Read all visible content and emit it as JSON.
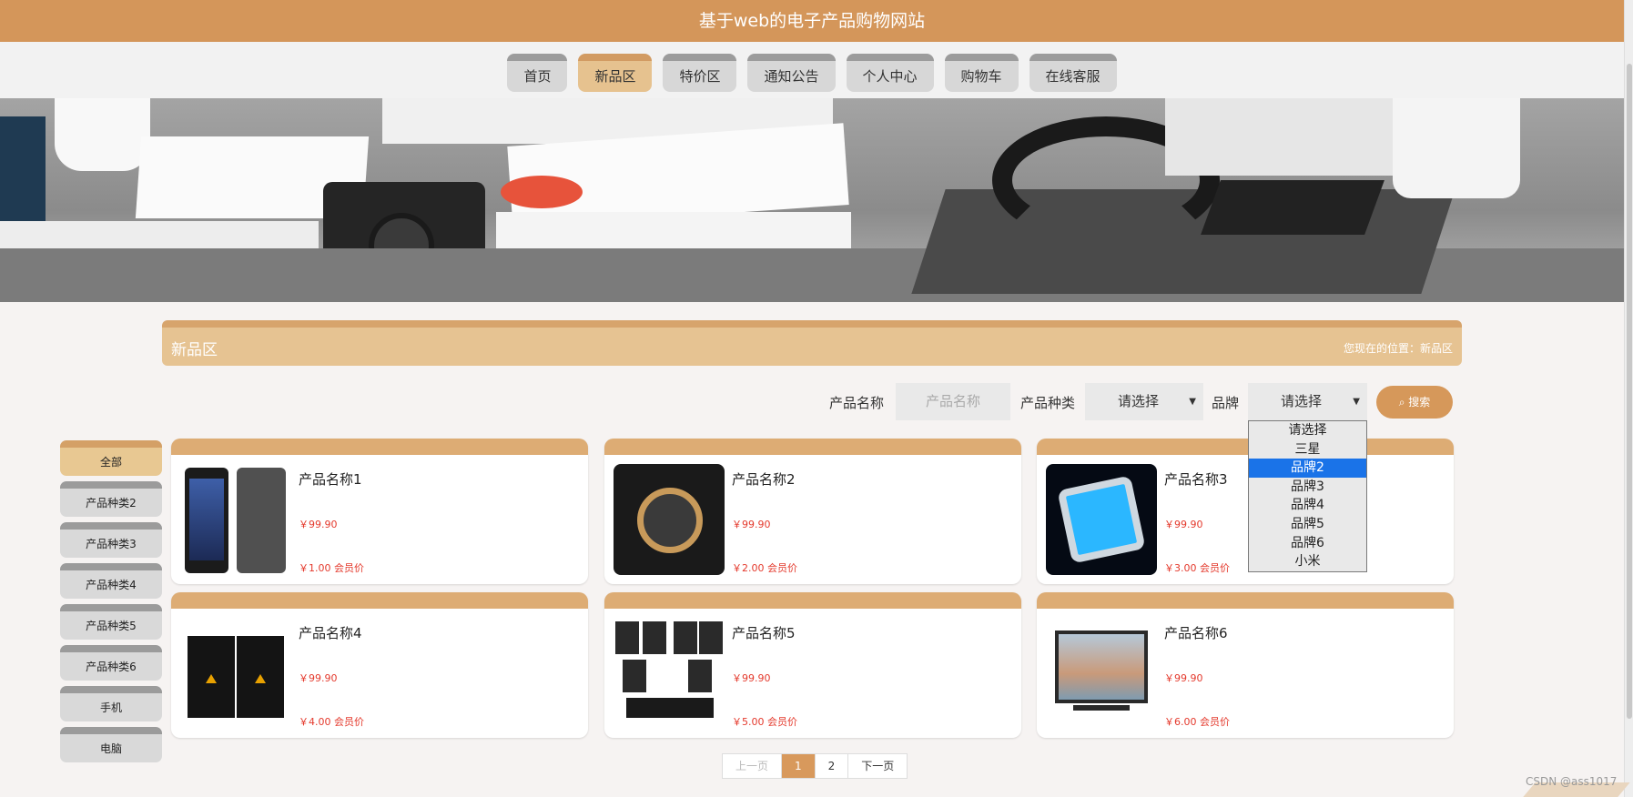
{
  "header": {
    "title": "基于web的电子产品购物网站"
  },
  "nav": {
    "items": [
      {
        "label": "首页",
        "active": false
      },
      {
        "label": "新品区",
        "active": true
      },
      {
        "label": "特价区",
        "active": false
      },
      {
        "label": "通知公告",
        "active": false
      },
      {
        "label": "个人中心",
        "active": false
      },
      {
        "label": "购物车",
        "active": false
      },
      {
        "label": "在线客服",
        "active": false
      }
    ]
  },
  "section": {
    "title": "新品区",
    "location": "您现在的位置：新品区"
  },
  "filters": {
    "name_label": "产品名称",
    "name_placeholder": "产品名称",
    "category_label": "产品种类",
    "category_value": "请选择",
    "brand_label": "品牌",
    "brand_value": "请选择",
    "search_label": "搜索",
    "brand_options": [
      "请选择",
      "三星",
      "品牌2",
      "品牌3",
      "品牌4",
      "品牌5",
      "品牌6",
      "小米"
    ],
    "brand_highlighted": "品牌2"
  },
  "sidebar": {
    "items": [
      "全部",
      "产品种类2",
      "产品种类3",
      "产品种类4",
      "产品种类5",
      "产品种类6",
      "手机",
      "电脑"
    ]
  },
  "products": [
    {
      "name": "产品名称1",
      "price": "￥99.90",
      "vip": "￥1.00 会员价"
    },
    {
      "name": "产品名称2",
      "price": "￥99.90",
      "vip": "￥2.00 会员价"
    },
    {
      "name": "产品名称3",
      "price": "￥99.90",
      "vip": "￥3.00 会员价"
    },
    {
      "name": "产品名称4",
      "price": "￥99.90",
      "vip": "￥4.00 会员价"
    },
    {
      "name": "产品名称5",
      "price": "￥99.90",
      "vip": "￥5.00 会员价"
    },
    {
      "name": "产品名称6",
      "price": "￥99.90",
      "vip": "￥6.00 会员价"
    }
  ],
  "pager": {
    "prev": "上一页",
    "pages": [
      "1",
      "2"
    ],
    "current": "1",
    "next": "下一页"
  },
  "watermark": "CSDN @ass1017",
  "colors": {
    "brand": "#d4965a",
    "price": "#e4392c",
    "selected_option": "#1a73e8"
  }
}
